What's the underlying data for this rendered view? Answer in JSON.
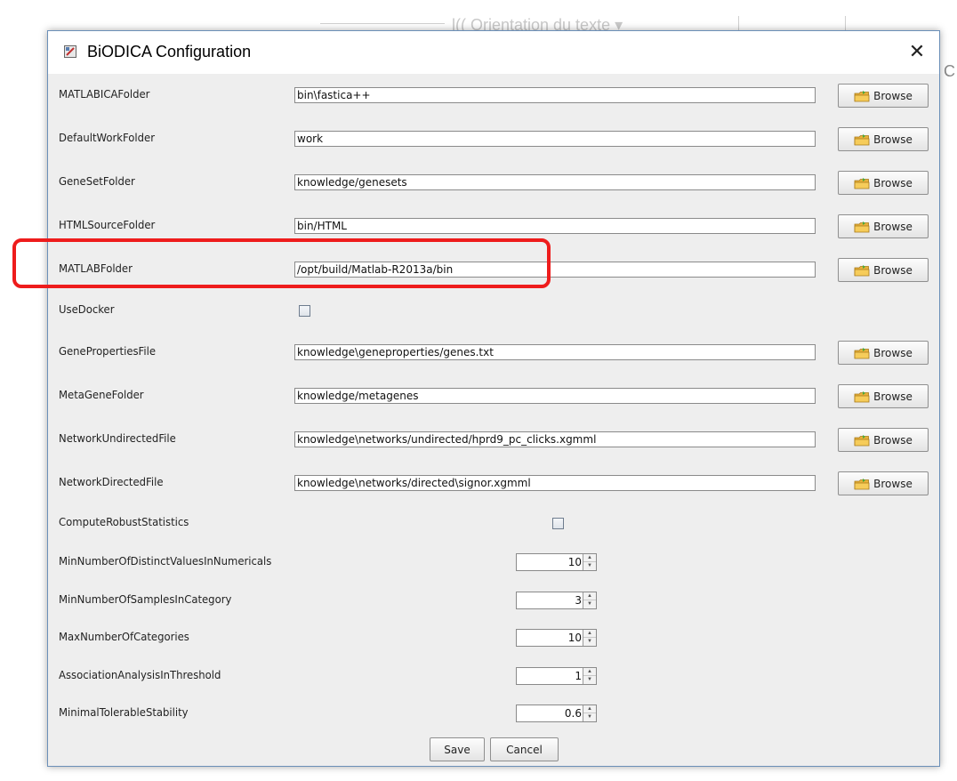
{
  "background": {
    "text": "l(( Orientation du texte ▾",
    "edge_char": "C"
  },
  "dialog": {
    "title": "BiODICA Configuration",
    "close_label": "✕"
  },
  "rows": [
    {
      "label": "MATLABICAFolder",
      "value": "bin\\fastica++",
      "browse": "Browse"
    },
    {
      "label": "DefaultWorkFolder",
      "value": "work",
      "browse": "Browse"
    },
    {
      "label": "GeneSetFolder",
      "value": "knowledge/genesets",
      "browse": "Browse"
    },
    {
      "label": "HTMLSourceFolder",
      "value": "bin/HTML",
      "browse": "Browse"
    },
    {
      "label": "MATLABFolder",
      "value": "/opt/build/Matlab-R2013a/bin",
      "browse": "Browse"
    },
    {
      "label": "UseDocker"
    },
    {
      "label": "GenePropertiesFile",
      "value": "knowledge\\geneproperties/genes.txt",
      "browse": "Browse"
    },
    {
      "label": "MetaGeneFolder",
      "value": "knowledge/metagenes",
      "browse": "Browse"
    },
    {
      "label": "NetworkUndirectedFile",
      "value": "knowledge\\networks/undirected/hprd9_pc_clicks.xgmml",
      "browse": "Browse"
    },
    {
      "label": "NetworkDirectedFile",
      "value": "knowledge\\networks/directed\\signor.xgmml",
      "browse": "Browse"
    },
    {
      "label": "ComputeRobustStatistics"
    },
    {
      "label": "MinNumberOfDistinctValuesInNumericals",
      "value": "10"
    },
    {
      "label": "MinNumberOfSamplesInCategory",
      "value": "3"
    },
    {
      "label": "MaxNumberOfCategories",
      "value": "10"
    },
    {
      "label": "AssociationAnalysisInThreshold",
      "value": "1"
    },
    {
      "label": "MinimalTolerableStability",
      "value": "0.6"
    }
  ],
  "buttons": {
    "save": "Save",
    "cancel": "Cancel"
  },
  "colors": {
    "highlight": "#ee1c1c",
    "dialog_border": "#6b8fb8",
    "content_bg": "#eeeeee"
  },
  "icons": {
    "app": "app-icon",
    "close": "close-icon",
    "browse": "folder-icon"
  }
}
